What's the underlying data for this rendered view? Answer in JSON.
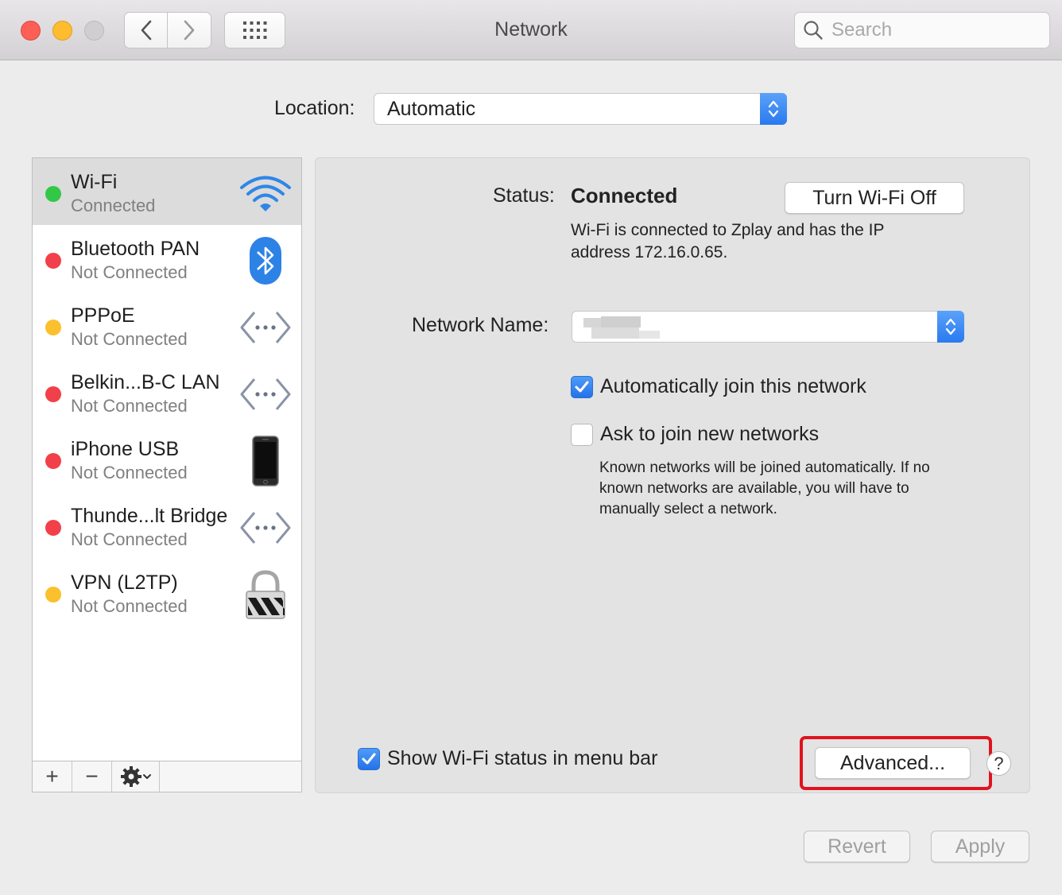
{
  "window": {
    "title": "Network"
  },
  "search": {
    "placeholder": "Search"
  },
  "location": {
    "label": "Location:",
    "value": "Automatic"
  },
  "services": [
    {
      "name": "Wi-Fi",
      "status": "Connected",
      "dot_color": "#33c748",
      "icon": "wifi-icon",
      "selected": true
    },
    {
      "name": "Bluetooth PAN",
      "status": "Not Connected",
      "dot_color": "#f2404a",
      "icon": "bluetooth-icon"
    },
    {
      "name": "PPPoE",
      "status": "Not Connected",
      "dot_color": "#fbc02d",
      "icon": "ethernet-arrows-icon"
    },
    {
      "name": "Belkin...B-C LAN",
      "status": "Not Connected",
      "dot_color": "#f2404a",
      "icon": "ethernet-arrows-icon"
    },
    {
      "name": "iPhone USB",
      "status": "Not Connected",
      "dot_color": "#f2404a",
      "icon": "iphone-icon"
    },
    {
      "name": "Thunde...lt Bridge",
      "status": "Not Connected",
      "dot_color": "#f2404a",
      "icon": "ethernet-arrows-icon"
    },
    {
      "name": "VPN (L2TP)",
      "status": "Not Connected",
      "dot_color": "#fbc02d",
      "icon": "lock-icon"
    }
  ],
  "sidebar_toolbar": {
    "add": "+",
    "remove": "−"
  },
  "detail": {
    "status_label": "Status:",
    "status_value": "Connected",
    "turn_off_label": "Turn Wi-Fi Off",
    "status_description": "Wi-Fi is connected to Zplay and has the IP address 172.16.0.65.",
    "network_name_label": "Network Name:",
    "network_name_value": "",
    "auto_join": {
      "label": "Automatically join this network",
      "checked": true
    },
    "ask_join": {
      "label": "Ask to join new networks",
      "checked": false
    },
    "help_text": "Known networks will be joined automatically. If no known networks are available, you will have to manually select a network.",
    "show_status": {
      "label": "Show Wi-Fi status in menu bar",
      "checked": true
    },
    "advanced_label": "Advanced...",
    "help_label": "?"
  },
  "footer": {
    "revert_label": "Revert",
    "apply_label": "Apply"
  },
  "colors": {
    "accent": "#2a7af0",
    "highlight": "#e0141e"
  }
}
